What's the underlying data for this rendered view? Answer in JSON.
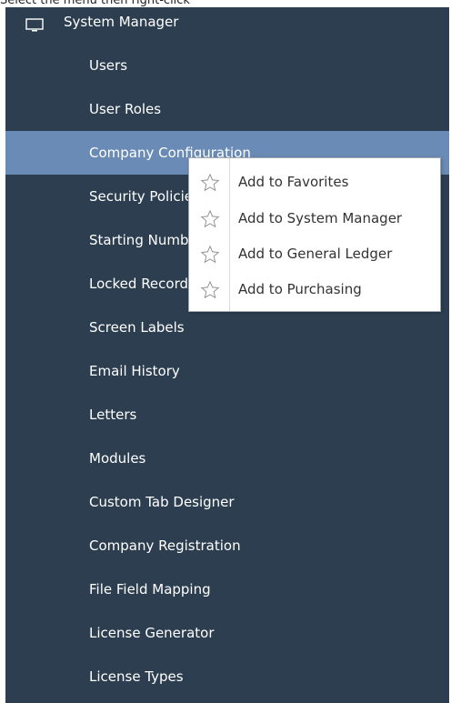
{
  "caption": "Select the menu then right-click",
  "sidebar": {
    "module": "System Manager",
    "items": [
      {
        "label": "Users"
      },
      {
        "label": "User Roles"
      },
      {
        "label": "Company Configuration",
        "selected": true
      },
      {
        "label": "Security Policies"
      },
      {
        "label": "Starting Numbers"
      },
      {
        "label": "Locked Records"
      },
      {
        "label": "Screen Labels"
      },
      {
        "label": "Email History"
      },
      {
        "label": "Letters"
      },
      {
        "label": "Modules"
      },
      {
        "label": "Custom Tab Designer"
      },
      {
        "label": "Company Registration"
      },
      {
        "label": "File Field Mapping"
      },
      {
        "label": "License Generator"
      },
      {
        "label": "License Types"
      }
    ]
  },
  "context_menu": {
    "items": [
      {
        "label": "Add to Favorites",
        "icon": "star-icon"
      },
      {
        "label": "Add to System Manager",
        "icon": "star-icon"
      },
      {
        "label": "Add to General Ledger",
        "icon": "star-icon"
      },
      {
        "label": "Add to Purchasing",
        "icon": "star-icon"
      }
    ]
  },
  "colors": {
    "sidebar_bg": "#2c3e50",
    "selected_bg": "#6a8bb5",
    "text": "#ffffff"
  }
}
